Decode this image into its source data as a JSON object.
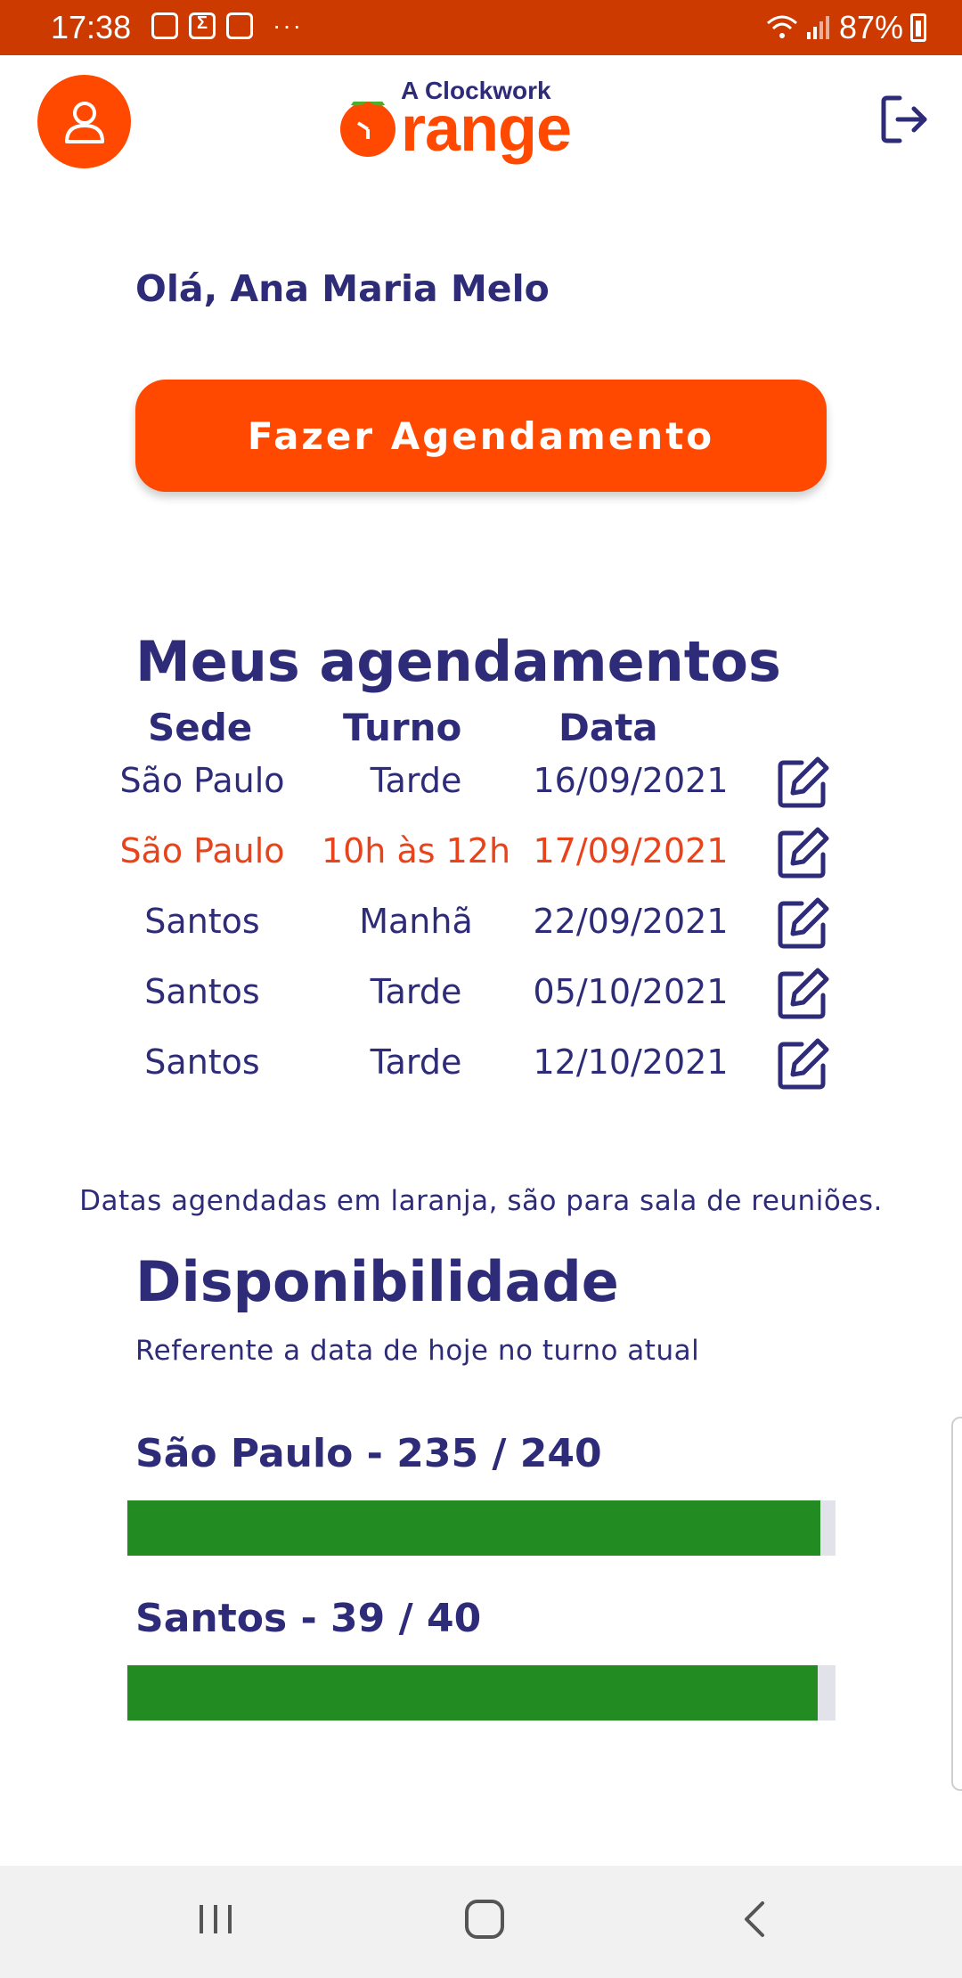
{
  "status_bar": {
    "time": "17:38",
    "notif_sigma": "Σ",
    "more": "···",
    "battery": "87%"
  },
  "header": {
    "logo_small": "A Clockwork",
    "logo_big": "range"
  },
  "greeting": "Olá, Ana Maria Melo",
  "cta_label": "Fazer Agendamento",
  "schedule": {
    "title": "Meus agendamentos",
    "columns": [
      "Sede",
      "Turno",
      "Data"
    ],
    "rows": [
      {
        "sede": "São Paulo",
        "turno": "Tarde",
        "data": "16/09/2021",
        "highlight": false
      },
      {
        "sede": "São Paulo",
        "turno": "10h às 12h",
        "data": "17/09/2021",
        "highlight": true
      },
      {
        "sede": "Santos",
        "turno": "Manhã",
        "data": "22/09/2021",
        "highlight": false
      },
      {
        "sede": "Santos",
        "turno": "Tarde",
        "data": "05/10/2021",
        "highlight": false
      },
      {
        "sede": "Santos",
        "turno": "Tarde",
        "data": "12/10/2021",
        "highlight": false
      }
    ],
    "note": "Datas agendadas em laranja, são para sala de reuniões."
  },
  "availability": {
    "title": "Disponibilidade",
    "subtitle": "Referente a data de hoje no turno atual",
    "items": [
      {
        "label": "São Paulo - 235 / 240",
        "used": 235,
        "total": 240
      },
      {
        "label": "Santos - 39 / 40",
        "used": 39,
        "total": 40
      }
    ]
  },
  "colors": {
    "brand": "#ff4800",
    "primary_text": "#2e2b78",
    "highlight_text": "#e8431a",
    "bar_fill": "#228b22",
    "bar_track": "#e2e2ea"
  }
}
